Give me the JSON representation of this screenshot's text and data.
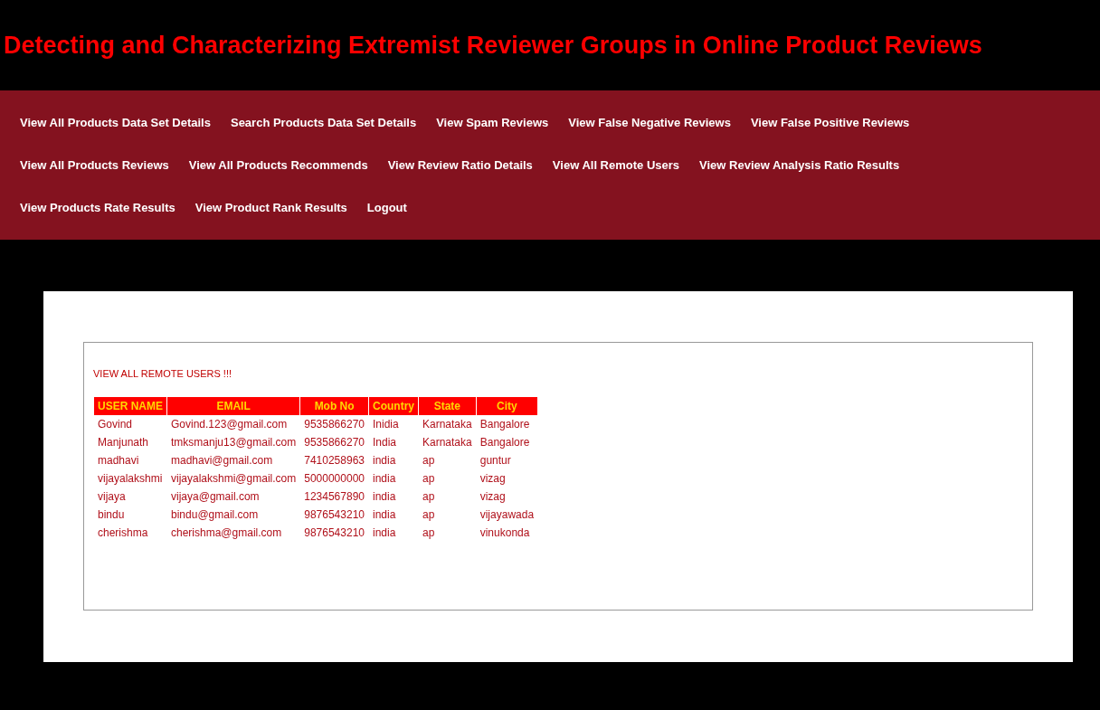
{
  "title": "Detecting and Characterizing Extremist Reviewer Groups in Online Product Reviews",
  "nav_rows": [
    [
      "View All Products Data Set Details",
      "Search Products Data Set Details",
      "View Spam Reviews",
      "View False Negative Reviews",
      "View False Positive Reviews"
    ],
    [
      "View All Products Reviews",
      "View All Products Recommends",
      "View Review Ratio Details",
      "View All Remote Users",
      "View Review Analysis Ratio Results"
    ],
    [
      "View Products Rate Results",
      "View Product Rank Results",
      "Logout"
    ]
  ],
  "section_heading": "VIEW ALL REMOTE USERS !!!",
  "table": {
    "columns": [
      "USER NAME",
      "EMAIL",
      "Mob No",
      "Country",
      "State",
      "City"
    ],
    "rows": [
      [
        "Govind",
        "Govind.123@gmail.com",
        "9535866270",
        "Inidia",
        "Karnataka",
        "Bangalore"
      ],
      [
        "Manjunath",
        "tmksmanju13@gmail.com",
        "9535866270",
        "India",
        "Karnataka",
        "Bangalore"
      ],
      [
        "madhavi",
        "madhavi@gmail.com",
        "7410258963",
        "india",
        "ap",
        "guntur"
      ],
      [
        "vijayalakshmi",
        "vijayalakshmi@gmail.com",
        "5000000000",
        "india",
        "ap",
        "vizag"
      ],
      [
        "vijaya",
        "vijaya@gmail.com",
        "1234567890",
        "india",
        "ap",
        "vizag"
      ],
      [
        "bindu",
        "bindu@gmail.com",
        "9876543210",
        "india",
        "ap",
        "vijayawada"
      ],
      [
        "cherishma",
        "cherishma@gmail.com",
        "9876543210",
        "india",
        "ap",
        "vinukonda"
      ]
    ]
  }
}
